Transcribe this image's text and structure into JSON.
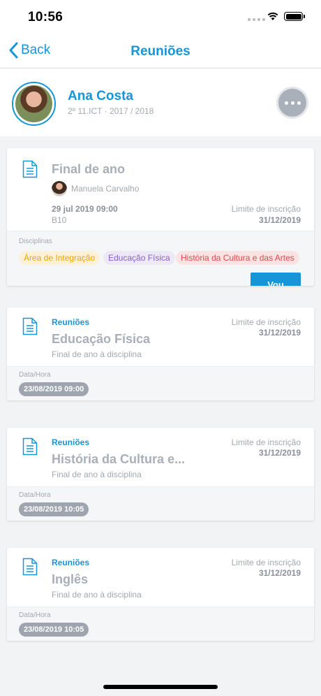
{
  "status_bar": {
    "time": "10:56"
  },
  "nav": {
    "back_label": "Back",
    "title": "Reuniões"
  },
  "profile": {
    "name": "Ana Costa",
    "class_info": "2º 11.ICT · 2017 / 2018"
  },
  "featured": {
    "title": "Final de ano",
    "organizer": "Manuela Carvalho",
    "datetime": "29 jul 2019 09:00",
    "room": "B10",
    "limit_label": "Limite de inscrição",
    "limit_date": "31/12/2019",
    "subjects_label": "Disciplinas",
    "subjects": [
      "Área de Integração",
      "Educação Física",
      "História da Cultura e das Artes"
    ],
    "subject_colors": [
      "#f0a30a",
      "#8b5fc8",
      "#e04545"
    ],
    "action_label": "Vou"
  },
  "meetings": [
    {
      "category": "Reuniões",
      "title": "Educação Física",
      "subtitle": "Final de ano à disciplina",
      "limit_label": "Limite de inscrição",
      "limit_date": "31/12/2019",
      "date_label": "Data/Hora",
      "date": "23/08/2019 09:00"
    },
    {
      "category": "Reuniões",
      "title": "História da Cultura e...",
      "subtitle": "Final de ano à disciplina",
      "limit_label": "Limite de inscrição",
      "limit_date": "31/12/2019",
      "date_label": "Data/Hora",
      "date": "23/08/2019 10:05"
    },
    {
      "category": "Reuniões",
      "title": "Inglês",
      "subtitle": "Final de ano à disciplina",
      "limit_label": "Limite de inscrição",
      "limit_date": "31/12/2019",
      "date_label": "Data/Hora",
      "date": "23/08/2019 10:05"
    }
  ],
  "colors": {
    "accent": "#1696d9",
    "muted": "#a9afb9",
    "pill": "#9fa5af"
  }
}
